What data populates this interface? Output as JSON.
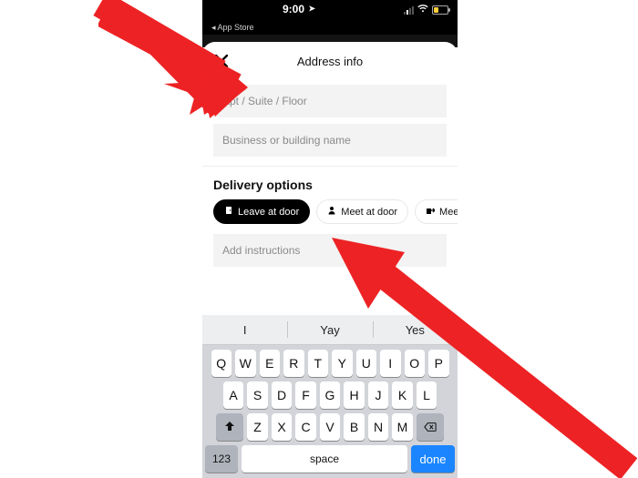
{
  "statusbar": {
    "time": "9:00",
    "back_label": "◂ App Store"
  },
  "modal": {
    "title": "Address info",
    "apt_placeholder": "Apt / Suite / Floor",
    "business_placeholder": "Business or building name"
  },
  "delivery": {
    "section_title": "Delivery options",
    "options": [
      {
        "label": "Leave at door",
        "icon": "door-icon",
        "active": true
      },
      {
        "label": "Meet at door",
        "icon": "person-icon",
        "active": false
      },
      {
        "label": "Meet ou",
        "icon": "outside-icon",
        "active": false
      }
    ],
    "instructions_placeholder": "Add instructions"
  },
  "keyboard": {
    "suggestions": [
      "I",
      "Yay",
      "Yes"
    ],
    "row1": [
      "Q",
      "W",
      "E",
      "R",
      "T",
      "Y",
      "U",
      "I",
      "O",
      "P"
    ],
    "row2": [
      "A",
      "S",
      "D",
      "F",
      "G",
      "H",
      "J",
      "K",
      "L"
    ],
    "row3": [
      "Z",
      "X",
      "C",
      "V",
      "B",
      "N",
      "M"
    ],
    "mode_key": "123",
    "space_key": "space",
    "done_key": "done"
  }
}
